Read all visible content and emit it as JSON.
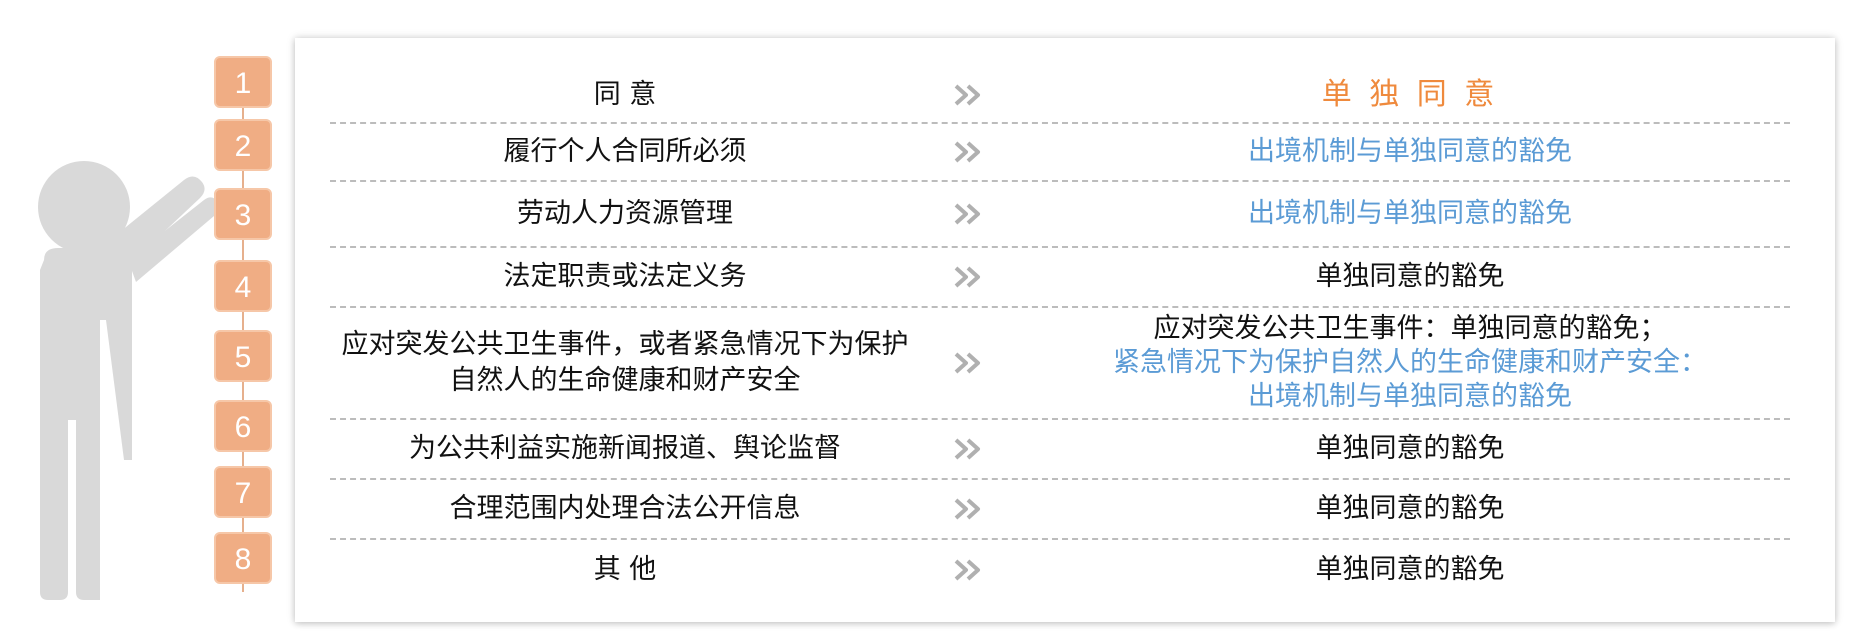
{
  "badges": [
    "1",
    "2",
    "3",
    "4",
    "5",
    "6",
    "7",
    "8"
  ],
  "rows": [
    {
      "left": [
        "同 意"
      ],
      "right": [
        {
          "text": "单 独 同 意",
          "color": "orange"
        }
      ]
    },
    {
      "left": [
        "履行个人合同所必须"
      ],
      "right": [
        {
          "text": "出境机制与单独同意的豁免",
          "color": "blue"
        }
      ]
    },
    {
      "left": [
        "劳动人力资源管理"
      ],
      "right": [
        {
          "text": "出境机制与单独同意的豁免",
          "color": "blue"
        }
      ]
    },
    {
      "left": [
        "法定职责或法定义务"
      ],
      "right": [
        {
          "text": "单独同意的豁免",
          "color": "dark"
        }
      ]
    },
    {
      "left": [
        "应对突发公共卫生事件，或者紧急情况下为保护",
        "自然人的生命健康和财产安全"
      ],
      "right": [
        {
          "text": "应对突发公共卫生事件：单独同意的豁免；",
          "color": "dark"
        },
        {
          "text": "紧急情况下为保护自然人的生命健康和财产安全：",
          "color": "blue"
        },
        {
          "text": "出境机制与单独同意的豁免",
          "color": "blue"
        }
      ]
    },
    {
      "left": [
        "为公共利益实施新闻报道、舆论监督"
      ],
      "right": [
        {
          "text": "单独同意的豁免",
          "color": "dark"
        }
      ]
    },
    {
      "left": [
        "合理范围内处理合法公开信息"
      ],
      "right": [
        {
          "text": "单独同意的豁免",
          "color": "dark"
        }
      ]
    },
    {
      "left": [
        "其 他"
      ],
      "right": [
        {
          "text": "单独同意的豁免",
          "color": "dark"
        }
      ]
    }
  ],
  "colors": {
    "badge": "#f0ad84",
    "orange": "#ef8a3d",
    "blue": "#5b9bd5",
    "arrow": "#b0b0b0",
    "figure": "#d9d9d9"
  },
  "icons": {
    "arrow": "double-chevron-right-icon",
    "figure": "person-pointing-icon"
  }
}
